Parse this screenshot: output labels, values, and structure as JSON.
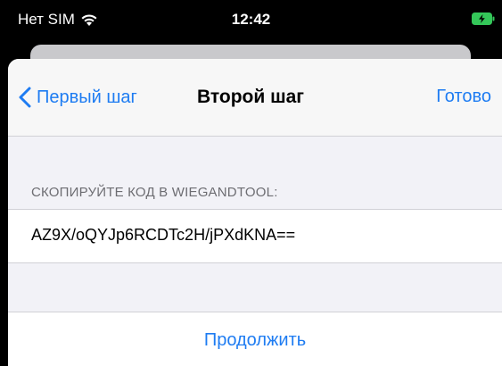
{
  "status_bar": {
    "carrier": "Нет SIM",
    "time": "12:42",
    "wifi_icon": "wifi-icon",
    "battery_icon": "battery-charging-icon",
    "battery_color": "#34c759"
  },
  "nav": {
    "back_label": "Первый шаг",
    "title": "Второй шаг",
    "done_label": "Готово",
    "accent_color": "#1e7cf2"
  },
  "section": {
    "header": "СКОПИРУЙТЕ КОД В WIEGANDTOOL:",
    "code": "AZ9X/oQYJp6RCDTc2H/jPXdKNA=="
  },
  "actions": {
    "continue_label": "Продолжить"
  }
}
